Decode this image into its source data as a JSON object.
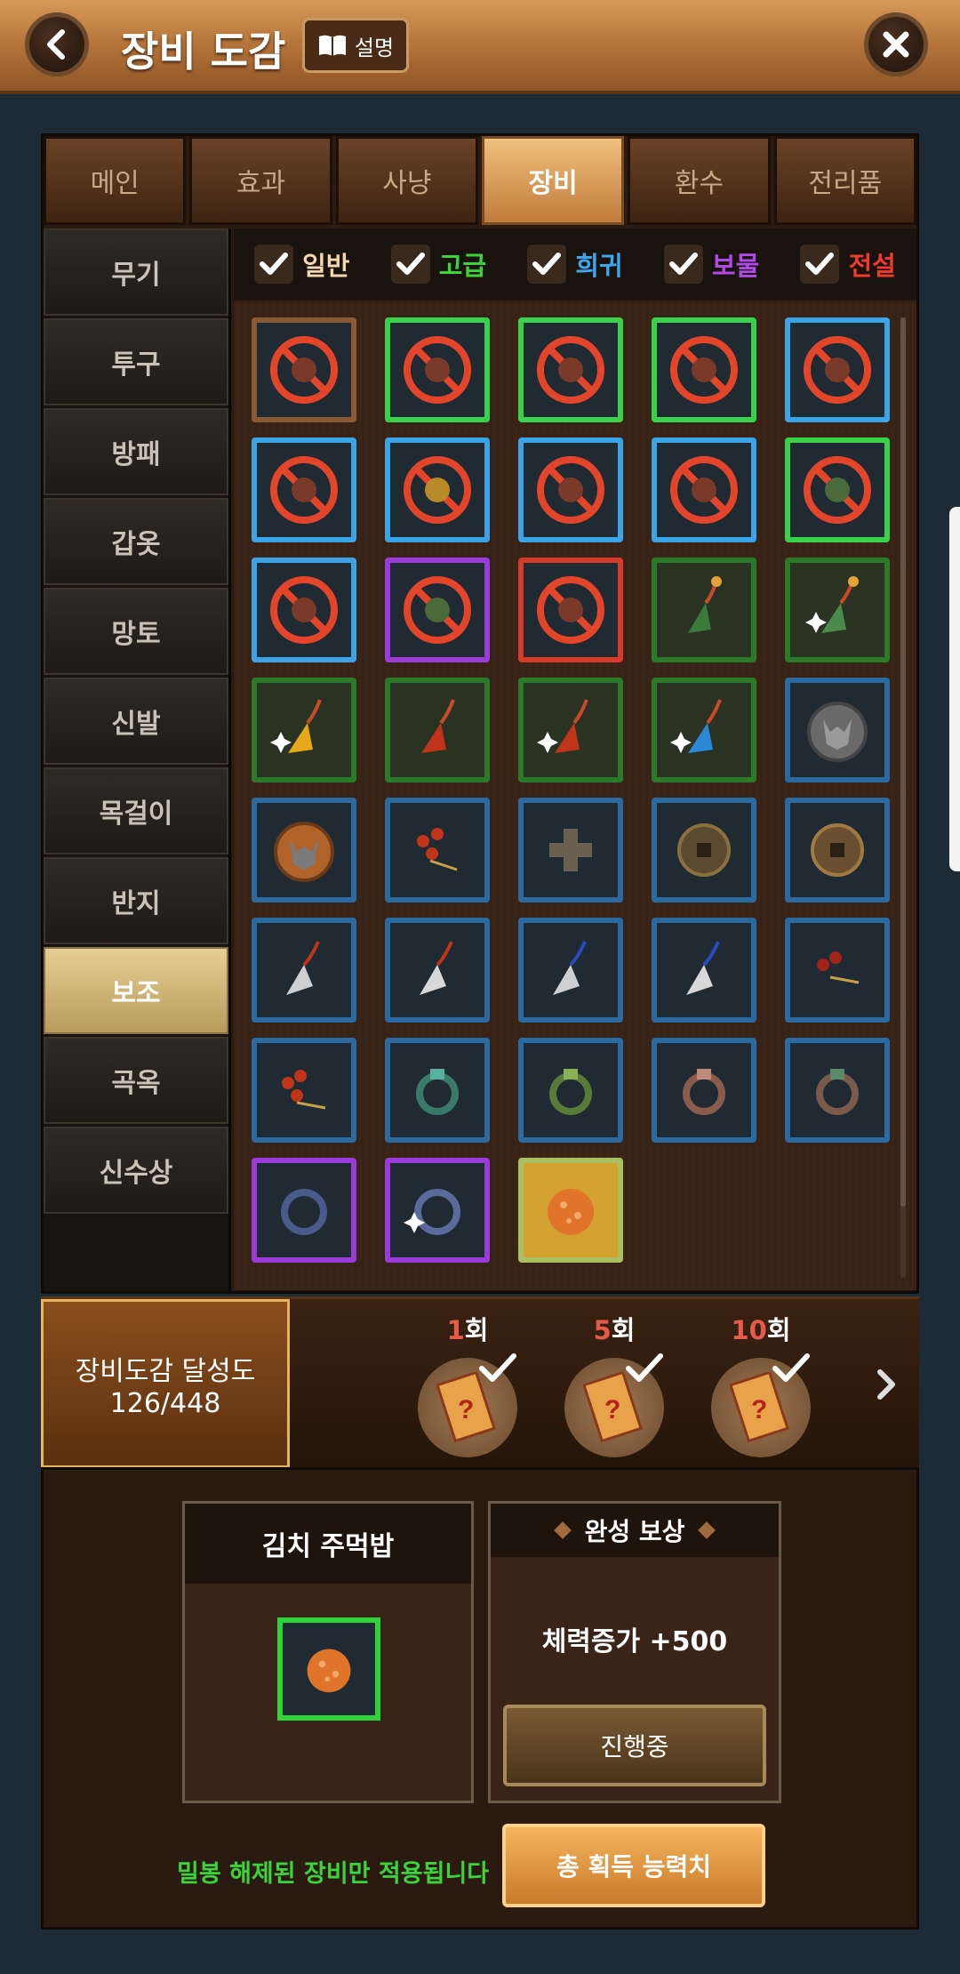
{
  "header": {
    "title": "장비 도감",
    "guide_label": "설명"
  },
  "tabs": [
    {
      "label": "메인",
      "active": false
    },
    {
      "label": "효과",
      "active": false
    },
    {
      "label": "사냥",
      "active": false
    },
    {
      "label": "장비",
      "active": true
    },
    {
      "label": "환수",
      "active": false
    },
    {
      "label": "전리품",
      "active": false
    }
  ],
  "sidebar": [
    {
      "label": "무기",
      "active": false
    },
    {
      "label": "투구",
      "active": false
    },
    {
      "label": "방패",
      "active": false
    },
    {
      "label": "갑옷",
      "active": false
    },
    {
      "label": "망토",
      "active": false
    },
    {
      "label": "신발",
      "active": false
    },
    {
      "label": "목걸이",
      "active": false
    },
    {
      "label": "반지",
      "active": false
    },
    {
      "label": "보조",
      "active": true
    },
    {
      "label": "곡옥",
      "active": false
    },
    {
      "label": "신수상",
      "active": false
    }
  ],
  "filters": [
    {
      "label": "일반",
      "color": "#f2d7b0",
      "checked": true
    },
    {
      "label": "고급",
      "color": "#3cd43a",
      "checked": true
    },
    {
      "label": "희귀",
      "color": "#3aa8f0",
      "checked": true
    },
    {
      "label": "보물",
      "color": "#b04ae8",
      "checked": true
    },
    {
      "label": "전설",
      "color": "#ef3b2d",
      "checked": true
    }
  ],
  "progress": {
    "label": "장비도감 달성도",
    "value": "126/448"
  },
  "rewards": [
    {
      "count": "1",
      "unit": "회",
      "claimed": true
    },
    {
      "count": "5",
      "unit": "회",
      "claimed": true
    },
    {
      "count": "10",
      "unit": "회",
      "claimed": true
    }
  ],
  "detail": {
    "item_name": "김치 주먹밥",
    "reward_title": "완성 보상",
    "reward_text": "체력증가 +500",
    "status_button": "진행중",
    "notice": "밀봉 해제된 장비만 적용됩니다",
    "total_button": "총 획득 능력치"
  }
}
